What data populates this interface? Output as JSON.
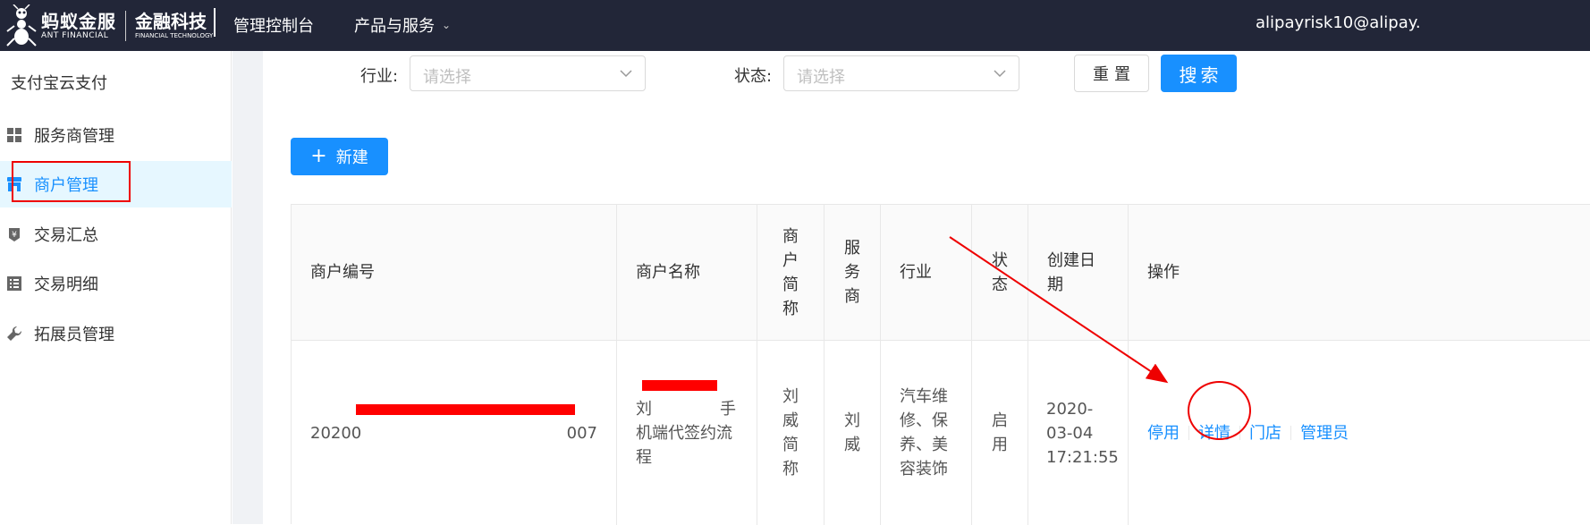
{
  "header": {
    "brand_cn": "蚂蚁金服",
    "brand_en": "ANT FINANCIAL",
    "brand2_cn": "金融科技",
    "brand2_en": "FINANCIAL TECHNOLOGY",
    "nav_console": "管理控制台",
    "nav_products": "产品与服务",
    "user": "alipayrisk10@alipay."
  },
  "sidebar": {
    "title": "支付宝云支付",
    "items": [
      {
        "label": "服务商管理",
        "icon": "grid-icon"
      },
      {
        "label": "商户管理",
        "icon": "shop-icon",
        "active": true
      },
      {
        "label": "交易汇总",
        "icon": "yen-icon"
      },
      {
        "label": "交易明细",
        "icon": "list-icon"
      },
      {
        "label": "拓展员管理",
        "icon": "wrench-icon"
      }
    ]
  },
  "filters": {
    "industry_label": "行业:",
    "industry_placeholder": "请选择",
    "status_label": "状态:",
    "status_placeholder": "请选择",
    "reset": "重置",
    "search": "搜索"
  },
  "new_button": "新建",
  "table": {
    "columns": [
      "商户编号",
      "商户名称",
      "商户简称",
      "服务商",
      "行业",
      "状态",
      "创建日期",
      "操作"
    ],
    "rows": [
      {
        "merchant_no_prefix": "20200",
        "merchant_no_suffix": "007",
        "merchant_name_prefix": "刘",
        "merchant_name_mid": "手",
        "merchant_name_rest": "机端代签约流程",
        "short_name": "刘威简称",
        "provider": "刘威",
        "industry": "汽车维修、保养、美容装饰",
        "status": "启用",
        "created": "2020-03-04 17:21:55",
        "actions": [
          "停用",
          "详情",
          "门店",
          "管理员"
        ]
      }
    ]
  }
}
